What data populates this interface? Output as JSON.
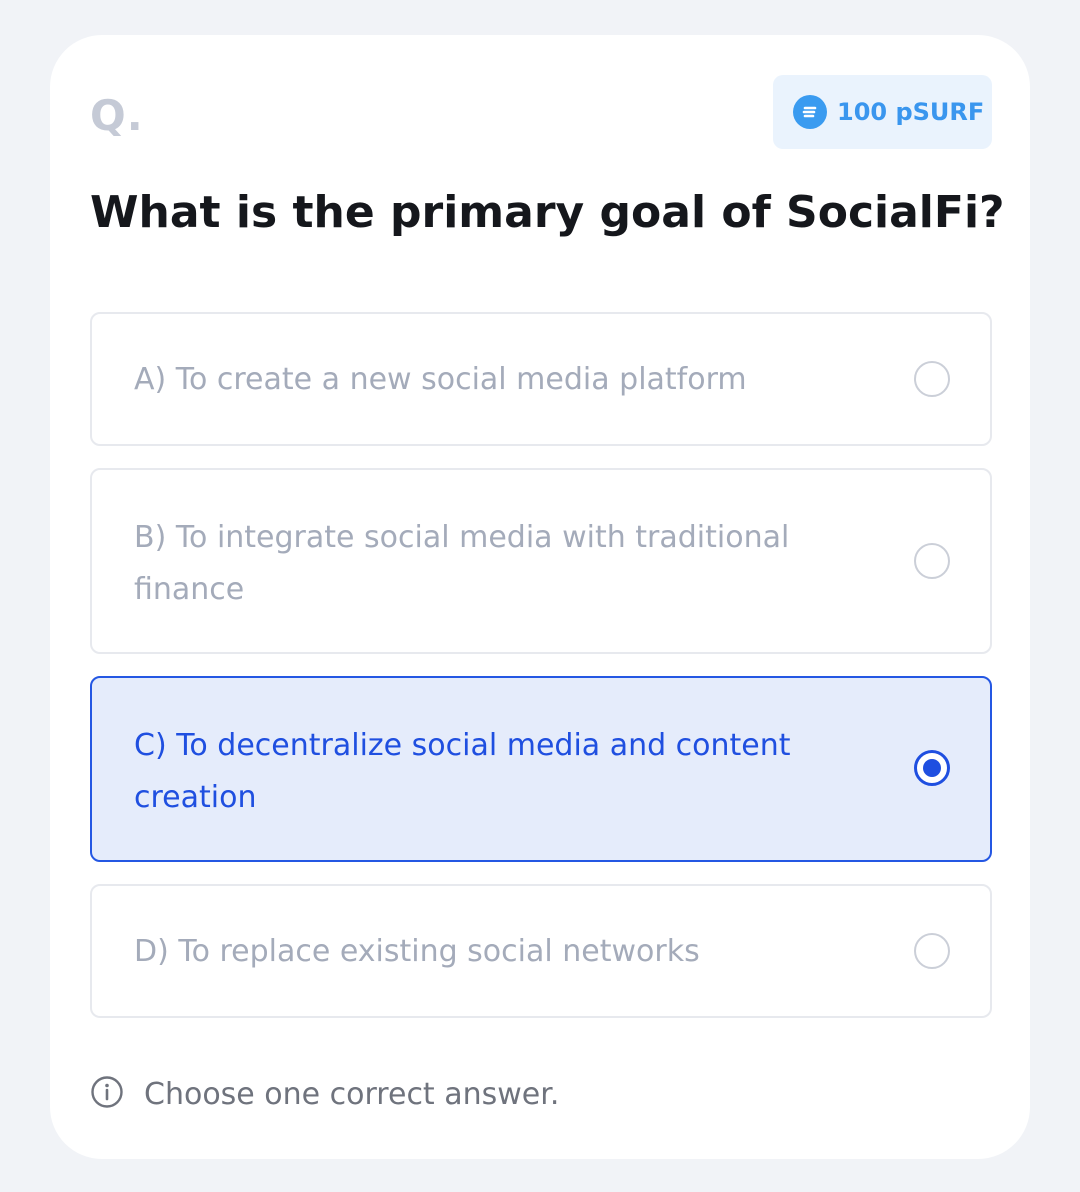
{
  "header": {
    "q_label": "Q.",
    "reward": {
      "label": "100 pSURF",
      "icon": "token-icon"
    }
  },
  "question": "What is the primary goal of SocialFi?",
  "options": [
    {
      "label": "A) To create a new social media platform",
      "selected": false
    },
    {
      "label": "B) To integrate social media with traditional finance",
      "selected": false
    },
    {
      "label": "C) To decentralize social media and content creation",
      "selected": true
    },
    {
      "label": "D) To replace existing social networks",
      "selected": false
    }
  ],
  "hint": {
    "icon": "info-icon",
    "text": "Choose one correct answer."
  },
  "colors": {
    "accent": "#1f4fe0",
    "selected_bg": "#e5ecfb",
    "reward_bg": "#eaf3fd",
    "reward_text": "#3a96ee"
  }
}
